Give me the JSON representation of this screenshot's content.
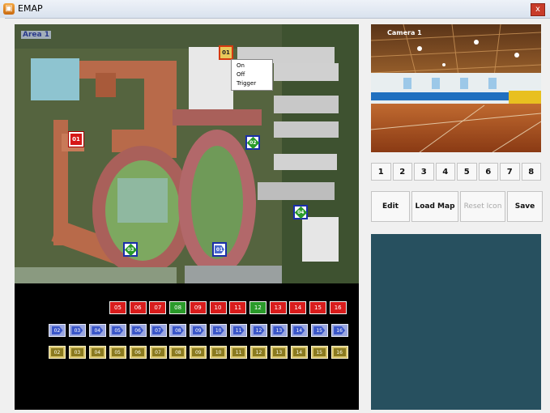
{
  "window": {
    "title": "EMAP",
    "close_glyph": "x"
  },
  "map": {
    "area_label": "Area 1",
    "markers": [
      {
        "id": "01",
        "type": "red"
      },
      {
        "id": "01",
        "type": "yellow"
      },
      {
        "id": "02",
        "type": "green"
      },
      {
        "id": "04",
        "type": "green"
      },
      {
        "id": "03",
        "type": "green"
      },
      {
        "id": "01",
        "type": "blue"
      }
    ],
    "context_menu": [
      "On",
      "Off",
      "Trigger"
    ]
  },
  "tray": {
    "row1": [
      {
        "id": "05",
        "type": "red"
      },
      {
        "id": "06",
        "type": "red"
      },
      {
        "id": "07",
        "type": "red"
      },
      {
        "id": "08",
        "type": "green"
      },
      {
        "id": "09",
        "type": "red"
      },
      {
        "id": "10",
        "type": "red"
      },
      {
        "id": "11",
        "type": "red"
      },
      {
        "id": "12",
        "type": "green"
      },
      {
        "id": "13",
        "type": "red"
      },
      {
        "id": "14",
        "type": "red"
      },
      {
        "id": "15",
        "type": "red"
      },
      {
        "id": "16",
        "type": "red"
      }
    ],
    "row2": [
      "02",
      "03",
      "04",
      "05",
      "06",
      "07",
      "08",
      "09",
      "10",
      "11",
      "12",
      "13",
      "14",
      "15",
      "16"
    ],
    "row3": [
      "02",
      "03",
      "04",
      "05",
      "06",
      "07",
      "08",
      "09",
      "10",
      "11",
      "12",
      "13",
      "14",
      "15",
      "16"
    ]
  },
  "camera": {
    "label": "Camera 1"
  },
  "camera_buttons": [
    "1",
    "2",
    "3",
    "4",
    "5",
    "6",
    "7",
    "8"
  ],
  "actions": {
    "edit": "Edit",
    "load_map": "Load Map",
    "reset_icon": "Reset Icon",
    "save": "Save"
  },
  "colors": {
    "info_panel": "#27505f",
    "alarm_red": "#d81c1c",
    "ok_green": "#2a9a2a",
    "cam_blue": "#3a56c8"
  }
}
